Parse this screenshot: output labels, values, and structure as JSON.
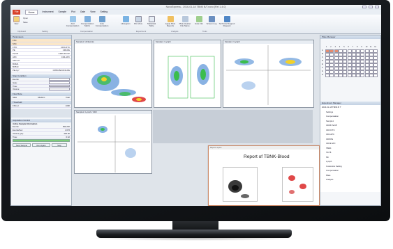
{
  "window": {
    "title": "NovoExpress - 2016-01-18 TBNK B/T.novo [Rel 1.4.0]"
  },
  "menu": {
    "items": [
      "File",
      "Home",
      "Instrument",
      "Sample",
      "Plot",
      "Gate",
      "View",
      "Setting"
    ],
    "active": "Home"
  },
  "ribbon": {
    "buttons": [
      "New",
      "Open",
      "Save",
      "Add Compensation",
      "Compensation Matrix",
      "Auto Compensation",
      "Histogram",
      "Plot View",
      "Statistical Table",
      "Apply Plots Reports",
      "Plate Header File Name",
      "Gate Info",
      "Screen Log",
      "Technical Support Request"
    ],
    "groups": [
      "Clipboard",
      "Setting",
      "Compensation",
      "Experiment",
      "Analysis",
      "Tools"
    ]
  },
  "parameters": {
    "title": "Parameters",
    "headers": [
      "",
      "Alias",
      "Gain",
      "H"
    ],
    "rows": [
      [
        "FSC",
        "",
        "",
        ""
      ],
      [
        "SSC",
        "",
        "",
        ""
      ],
      [
        "FITC",
        "CD3-FITC",
        "",
        ""
      ],
      [
        "PE",
        "CD8-PE",
        "",
        ""
      ],
      [
        "PerCP",
        "CD45-PerCP",
        "",
        ""
      ],
      [
        "APC",
        "CD4-APC",
        "",
        ""
      ],
      [
        "APC-H7",
        "",
        "",
        ""
      ],
      [
        "BV421",
        "",
        "",
        ""
      ],
      [
        "BV510",
        "",
        "",
        ""
      ],
      [
        "PE-Cy7",
        "CD56-PE/CD16-PE",
        "",
        ""
      ]
    ]
  },
  "stop_condition": {
    "title": "Stop Condition",
    "events_label": "Events:",
    "gate_label": "Gate:",
    "time_label": "Time:",
    "volume_label": "Volume:"
  },
  "flow_rate": {
    "title": "Flow Rate",
    "options": [
      "Slow",
      "Medium",
      "Fast"
    ]
  },
  "threshold": {
    "title": "Threshold",
    "channel": "FSC-H",
    "value": "1000"
  },
  "acquisition": {
    "title": "Acquisition Control",
    "sample_label": "Active Sample Information",
    "rows": [
      [
        "Events:",
        "996,252"
      ],
      [
        "Events/Sec:",
        "4,676"
      ],
      [
        "Volume (µL):",
        "200.00"
      ],
      [
        "Time:",
        "0:42"
      ]
    ],
    "progress": 1.0,
    "buttons": [
      "Next Sample",
      "Run Again",
      "Stop"
    ]
  },
  "plots": [
    {
      "header": "Sample1 / All Events",
      "xlabel": "CD45 PerCP-Cy5.5-A",
      "ylabel": "SSC-A"
    },
    {
      "header": "Sample1 / Lymph",
      "xlabel": "CD3 FITC-A",
      "ylabel": "CD19 APC-A"
    },
    {
      "header": "Sample1 / Lymph",
      "xlabel": "CD3 FITC-A",
      "ylabel": "CD4 APC-A"
    },
    {
      "header": "Sample1 / Lymph / CD3",
      "xlabel": "CD8 PE-A",
      "ylabel": "CD4 APC-A"
    }
  ],
  "plate_manager": {
    "title": "Plate Manager",
    "rows": [
      "A",
      "B",
      "C",
      "D",
      "E",
      "F",
      "G",
      "H"
    ],
    "columns": [
      "1",
      "2",
      "3",
      "4",
      "5",
      "6",
      "7",
      "8",
      "9",
      "10",
      "11",
      "12"
    ]
  },
  "experiment_manager": {
    "title": "Experiment Manager",
    "items": [
      "2016-01-18 TBNK B T",
      "Settings",
      "Compensation",
      "Sample1",
      "CD45 PerCP",
      "CD3 FITC",
      "CD4 APC",
      "CD8 PE",
      "CD19 APC",
      "TBNK",
      "T4/T8",
      "NK",
      "Lymph",
      "Customize Setting",
      "Compensation",
      "Plate",
      "Analysis"
    ]
  },
  "report": {
    "title": "Report of TBNK-Blood",
    "header": "Report Layout"
  },
  "colors": {
    "accent": "#d8402a",
    "panel_header": "#c3d1e2",
    "bezel": "#111417"
  }
}
